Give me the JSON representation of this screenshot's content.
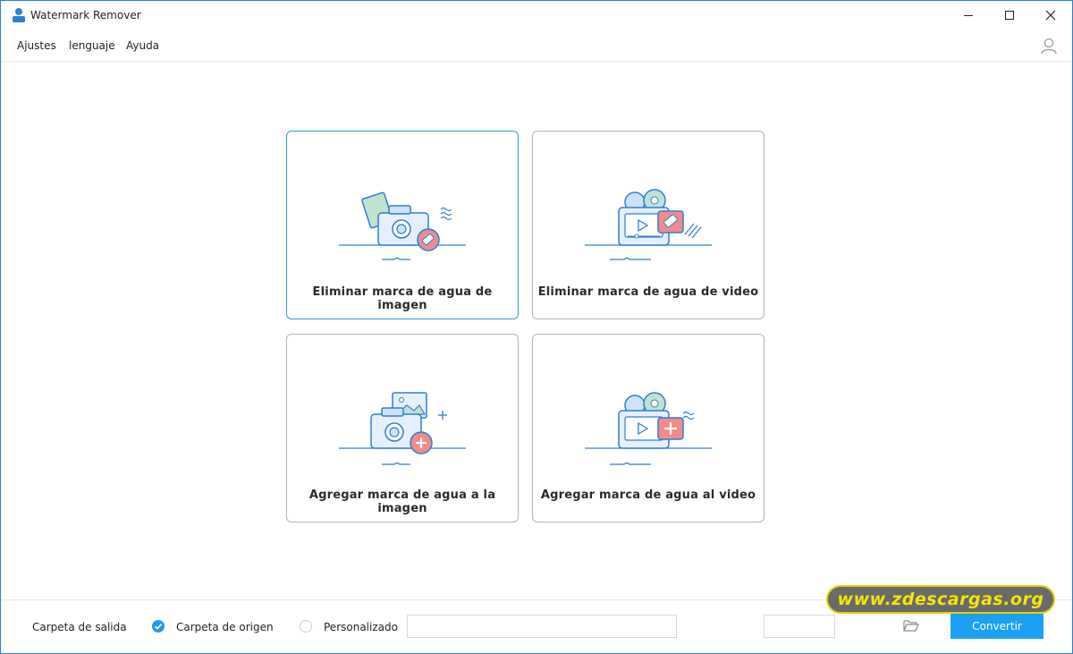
{
  "window": {
    "title": "Watermark Remover",
    "controls": [
      "minimize",
      "maximize",
      "close"
    ]
  },
  "menu": {
    "items": [
      "Ajustes",
      "lenguaje",
      "Ayuda"
    ]
  },
  "cards": [
    {
      "label": "Eliminar marca de agua de imagen",
      "icon": "camera-eraser-icon"
    },
    {
      "label": "Eliminar marca de agua de video",
      "icon": "video-eraser-icon"
    },
    {
      "label": "Agregar marca de agua a la imagen",
      "icon": "camera-add-icon"
    },
    {
      "label": "Agregar marca de agua al video",
      "icon": "video-add-icon"
    }
  ],
  "footer": {
    "output_label": "Carpeta de salida",
    "option_source": "Carpeta de origen",
    "option_custom": "Personalizado",
    "path_value": "",
    "convert_label": "Convertir"
  },
  "watermark_text": "www.zdescargas.org",
  "colors": {
    "accent": "#1aa1f5",
    "active_border": "#2b9fd6",
    "illus_blue": "#2f7ed6",
    "illus_red": "#f08c8c"
  }
}
